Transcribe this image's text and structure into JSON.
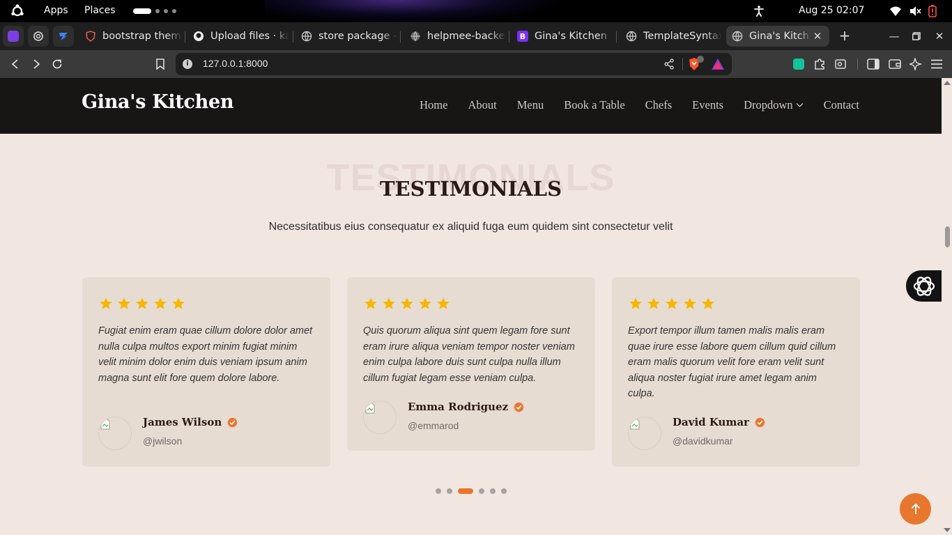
{
  "topbar": {
    "apps": "Apps",
    "places": "Places",
    "clock": "Aug 25  02:07"
  },
  "tabs": [
    {
      "title": "bootstrap them"
    },
    {
      "title": "Upload files · ka"
    },
    {
      "title": "store package -"
    },
    {
      "title": "helpmee-backe"
    },
    {
      "title": "Gina's Kitchen"
    },
    {
      "title": "TemplateSyntax"
    },
    {
      "title": "Gina's Kitch",
      "active": true
    }
  ],
  "address_bar": {
    "url": "127.0.0.1:8000"
  },
  "site": {
    "brand": "Gina's Kitchen",
    "nav": [
      "Home",
      "About",
      "Menu",
      "Book a Table",
      "Chefs",
      "Events",
      "Dropdown",
      "Contact"
    ]
  },
  "testimonials": {
    "ghost_title": "TESTIMONIALS",
    "title": "TESTIMONIALS",
    "subtitle": "Necessitatibus eius consequatur ex aliquid fuga eum quidem sint consectetur velit",
    "rating_stars": 5,
    "items": [
      {
        "quote": "Fugiat enim eram quae cillum dolore dolor amet nulla culpa multos export minim fugiat minim velit minim dolor enim duis veniam ipsum anim magna sunt elit fore quem dolore labore.",
        "name": "James Wilson",
        "handle": "@jwilson"
      },
      {
        "quote": "Quis quorum aliqua sint quem legam fore sunt eram irure aliqua veniam tempor noster veniam enim culpa labore duis sunt culpa nulla illum cillum fugiat legam esse veniam culpa.",
        "name": "Emma Rodriguez",
        "handle": "@emmarod"
      },
      {
        "quote": "Export tempor illum tamen malis malis eram quae irure esse labore quem cillum quid cillum eram malis quorum velit fore eram velit sunt aliqua noster fugiat irure amet legam anim culpa.",
        "name": "David Kumar",
        "handle": "@davidkumar"
      }
    ],
    "pagination": {
      "count": 6,
      "active_index": 2
    }
  },
  "colors": {
    "accent": "#e8772e",
    "star": "#f5b700",
    "header_bg": "#171615",
    "page_bg": "#f1e6e0",
    "card_bg": "#e7dcd2"
  }
}
